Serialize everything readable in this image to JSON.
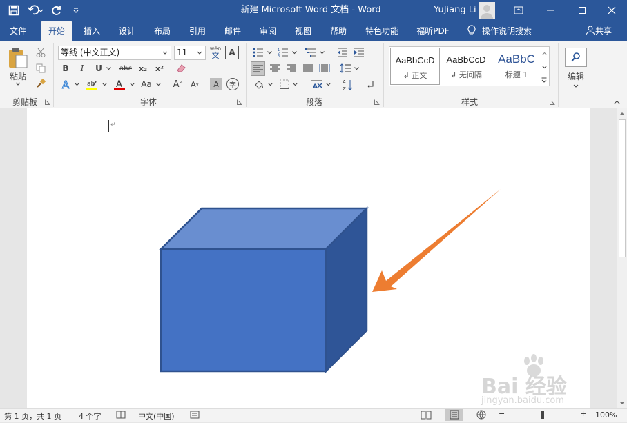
{
  "app": {
    "window_title": "新建 Microsoft Word 文档  -  Word",
    "user_name": "YuJiang Li"
  },
  "tabs": [
    "文件",
    "开始",
    "插入",
    "设计",
    "布局",
    "引用",
    "邮件",
    "审阅",
    "视图",
    "帮助",
    "特色功能",
    "福昕PDF"
  ],
  "tell_me": "操作说明搜索",
  "share": "共享",
  "clipboard": {
    "paste": "粘贴",
    "group": "剪贴板"
  },
  "font": {
    "name": "等线 (中文正文)",
    "size": "11",
    "group": "字体",
    "pinyin_top": "wén",
    "pinyin_bottom": "文",
    "bold": "B",
    "italic": "I",
    "underline": "U",
    "strike": "abc",
    "sub": "x₂",
    "sup": "x²",
    "case": "Aa",
    "grow": "A",
    "shrink": "A",
    "shade": "A",
    "circle": "字",
    "border_char": "A"
  },
  "paragraph": {
    "group": "段落"
  },
  "styles": {
    "group": "样式",
    "items": [
      {
        "sample": "AaBbCcD",
        "name": "↲ 正文"
      },
      {
        "sample": "AaBbCcD",
        "name": "↲ 无间隔"
      },
      {
        "sample": "AaBbC",
        "name": "标题 1"
      }
    ]
  },
  "editing": {
    "label": "编辑"
  },
  "document": {
    "paragraph_mark": "↵"
  },
  "status": {
    "page": "第 1 页，共 1 页",
    "words": "4 个字",
    "lang": "中文(中国)",
    "zoom": "100%"
  },
  "watermark": {
    "brand": "Bai 经验",
    "url": "jingyan.baidu.com"
  },
  "colors": {
    "brand": "#2b579a",
    "cube_front": "#4472c4",
    "cube_top": "#698ed0",
    "cube_side": "#2f5597",
    "cube_edge": "#2f528f",
    "arrow": "#ed7d31"
  }
}
